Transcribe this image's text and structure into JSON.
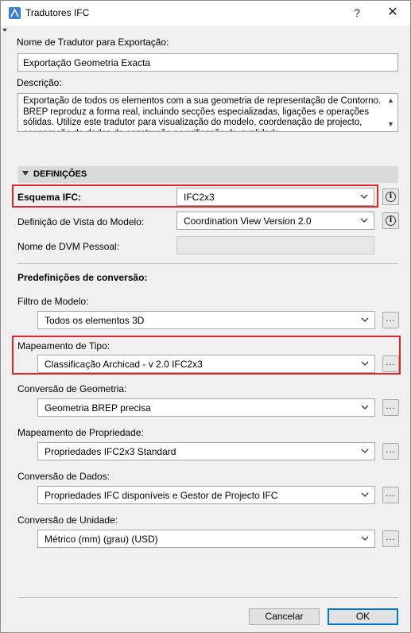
{
  "window": {
    "title": "Tradutores IFC",
    "help_label": "?",
    "close_label": "✕",
    "app_icon": "archicad-logo-icon"
  },
  "translator_name": {
    "label": "Nome de Tradutor para Exportação:",
    "value": "Exportação Geometria Exacta"
  },
  "description": {
    "label": "Descrição:",
    "value": "Exportação de todos os elementos com a sua geometria de representação de Contorno. BREP reproduz a forma real, incluindo secções especializadas, ligações e operações sólidas. Utilize este tradutor para visualização do modelo, coordenação de projecto, cooperação de dados de construção e verificação de qualidade."
  },
  "section": {
    "label": "DEFINIÇÕES",
    "expanded": true
  },
  "ifc_schema": {
    "label": "Esquema IFC:",
    "value": "IFC2x3",
    "info_icon": "info-icon"
  },
  "model_view": {
    "label": "Definição de Vista do Modelo:",
    "value": "Coordination View Version 2.0",
    "info_icon": "info-icon"
  },
  "custom_mvd": {
    "label": "Nome de DVM Pessoal:",
    "value": ""
  },
  "presets": {
    "heading": "Predefinições de conversão:",
    "items": [
      {
        "label": "Filtro de Modelo:",
        "value": "Todos os elementos 3D",
        "button": "..."
      },
      {
        "label": "Mapeamento de Tipo:",
        "value": "Classificação Archicad - v 2.0 IFC2x3",
        "button": "..."
      },
      {
        "label": "Conversão de Geometria:",
        "value": "Geometria BREP precisa",
        "button": "..."
      },
      {
        "label": "Mapeamento de Propriedade:",
        "value": "Propriedades IFC2x3 Standard",
        "button": "..."
      },
      {
        "label": "Conversão de Dados:",
        "value": "Propriedades IFC disponíveis e Gestor de Projecto IFC",
        "button": "..."
      },
      {
        "label": "Conversão de Unidade:",
        "value": "Métrico (mm) (grau) (USD)",
        "button": "..."
      }
    ]
  },
  "footer": {
    "cancel_label": "Cancelar",
    "ok_label": "OK"
  },
  "colors": {
    "highlight": "#e0262a",
    "primary_border": "#0078d7"
  }
}
